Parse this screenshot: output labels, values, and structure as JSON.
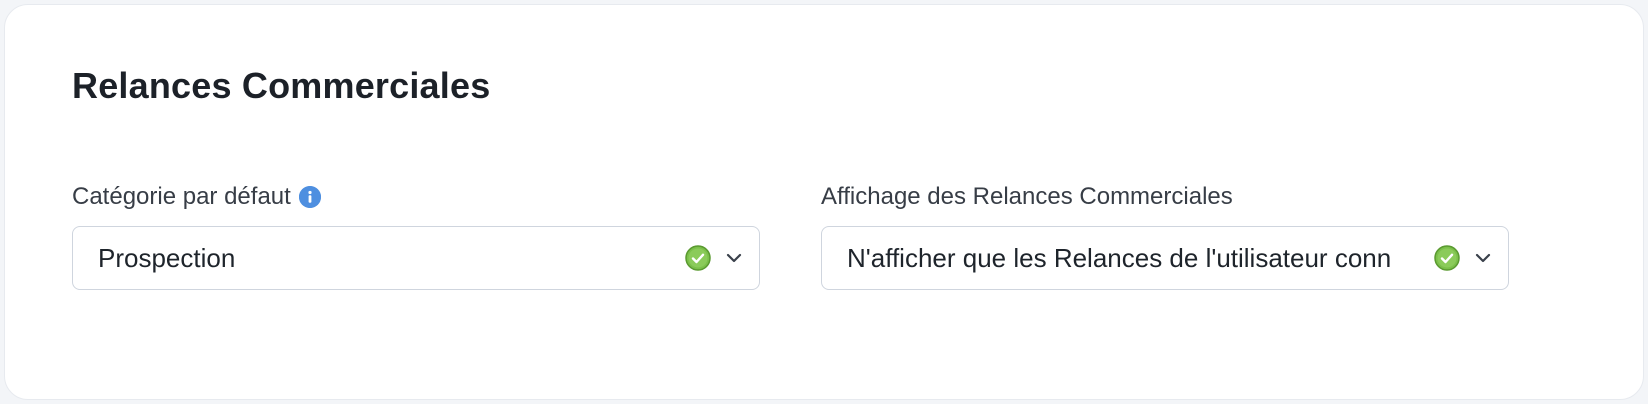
{
  "section": {
    "title": "Relances Commerciales"
  },
  "fields": {
    "default_category": {
      "label": "Catégorie par défaut",
      "value": "Prospection",
      "info_icon": "info-icon",
      "status_icon": "check-circle-icon"
    },
    "display": {
      "label": "Affichage des Relances Commerciales",
      "value": "N'afficher que les Relances de l'utilisateur conn",
      "status_icon": "check-circle-icon"
    }
  },
  "colors": {
    "info": "#4e8fe0",
    "valid": "#6db33f",
    "border": "#cfd5de"
  }
}
